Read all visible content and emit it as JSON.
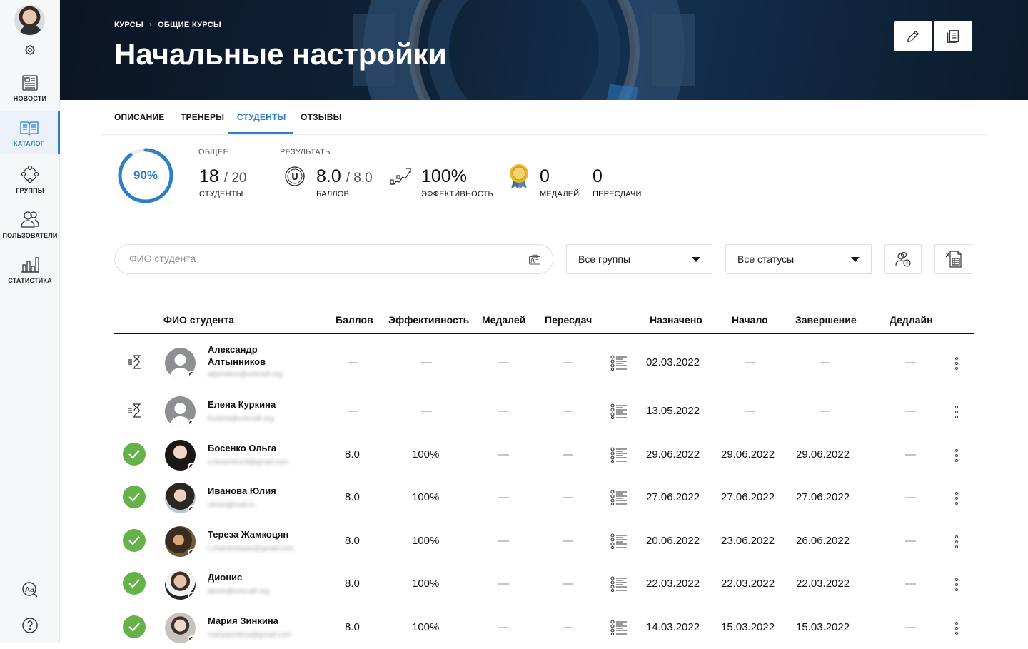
{
  "sidebar": {
    "items": [
      {
        "label": "НОВОСТИ"
      },
      {
        "label": "КАТАЛОГ"
      },
      {
        "label": "ГРУППЫ"
      },
      {
        "label": "ПОЛЬЗОВАТЕЛИ"
      },
      {
        "label": "СТАТИСТИКА"
      }
    ],
    "active": "КАТАЛОГ"
  },
  "header": {
    "breadcrumb": [
      "КУРСЫ",
      "ОБЩИЕ КУРСЫ"
    ],
    "title": "Начальные настройки"
  },
  "tabs": [
    {
      "label": "ОПИСАНИЕ"
    },
    {
      "label": "ТРЕНЕРЫ"
    },
    {
      "label": "СТУДЕНТЫ"
    },
    {
      "label": "ОТЗЫВЫ"
    }
  ],
  "active_tab": "СТУДЕНТЫ",
  "stats": {
    "progress_percent": 90,
    "progress_label": "90%",
    "general_caption": "ОБЩЕЕ",
    "results_caption": "РЕЗУЛЬТАТЫ",
    "students_value": "18",
    "students_total": "/ 20",
    "students_label": "СТУДЕНТЫ",
    "score_value": "8.0",
    "score_total": "/ 8.0",
    "score_label": "БАЛЛОВ",
    "efficiency_value": "100%",
    "efficiency_label": "ЭФФЕКТИВНОСТЬ",
    "medals_value": "0",
    "medals_label": "МЕДАЛЕЙ",
    "retakes_value": "0",
    "retakes_label": "ПЕРЕСДАЧИ"
  },
  "filters": {
    "search_placeholder": "ФИО студента",
    "groups_select": "Все группы",
    "status_select": "Все статусы"
  },
  "table": {
    "columns": [
      "ФИО студента",
      "Баллов",
      "Эффективность",
      "Медалей",
      "Пересдач",
      "Назначено",
      "Начало",
      "Завершение",
      "Дедлайн"
    ],
    "rows": [
      {
        "status": "in-progress",
        "name": "Александр Алтынников",
        "email": "altynnikov@unicraft.org",
        "score": "—",
        "efficiency": "—",
        "medals": "—",
        "retakes": "—",
        "assigned": "02.03.2022",
        "start": "—",
        "end": "—",
        "deadline": "—"
      },
      {
        "status": "in-progress",
        "name": "Елена Куркина",
        "email": "kurkina@unicraft.org",
        "score": "—",
        "efficiency": "—",
        "medals": "—",
        "retakes": "—",
        "assigned": "13.05.2022",
        "start": "—",
        "end": "—",
        "deadline": "—"
      },
      {
        "status": "completed",
        "name": "Босенко Ольга",
        "email": "o.bosenko19@gmail.com",
        "score": "8.0",
        "efficiency": "100%",
        "medals": "—",
        "retakes": "—",
        "assigned": "29.06.2022",
        "start": "29.06.2022",
        "end": "29.06.2022",
        "deadline": "—"
      },
      {
        "status": "completed",
        "name": "Иванова Юлия",
        "email": "ulivan@mail.ru",
        "score": "8.0",
        "efficiency": "100%",
        "medals": "—",
        "retakes": "—",
        "assigned": "27.06.2022",
        "start": "27.06.2022",
        "end": "27.06.2022",
        "deadline": "—"
      },
      {
        "status": "completed",
        "name": "Тереза Жамкоцян",
        "email": "t.zhamkotsyan@gmail.com",
        "score": "8.0",
        "efficiency": "100%",
        "medals": "—",
        "retakes": "—",
        "assigned": "20.06.2022",
        "start": "23.06.2022",
        "end": "26.06.2022",
        "deadline": "—"
      },
      {
        "status": "completed",
        "name": "Дионис",
        "email": "dionis@unicraft.org",
        "score": "8.0",
        "efficiency": "100%",
        "medals": "—",
        "retakes": "—",
        "assigned": "22.03.2022",
        "start": "22.03.2022",
        "end": "22.03.2022",
        "deadline": "—"
      },
      {
        "status": "completed",
        "name": "Мария Зинкина",
        "email": "mariyazinkina@gmail.com",
        "score": "8.0",
        "efficiency": "100%",
        "medals": "—",
        "retakes": "—",
        "assigned": "14.03.2022",
        "start": "15.03.2022",
        "end": "15.03.2022",
        "deadline": "—"
      }
    ]
  },
  "colors": {
    "accent": "#2c7fc6",
    "success": "#66b24a",
    "hero_bg": "#0f2338"
  }
}
